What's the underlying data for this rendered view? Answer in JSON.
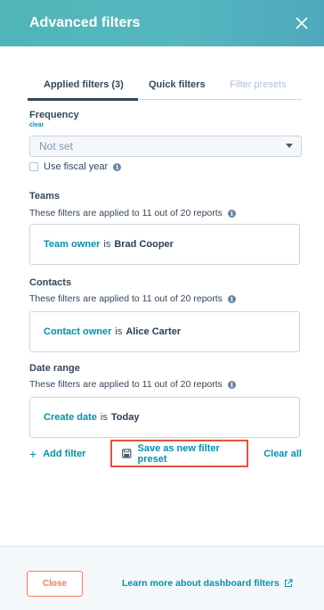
{
  "header": {
    "title": "Advanced filters",
    "close_icon": "close-icon"
  },
  "tabs": [
    {
      "label": "Applied filters (3)",
      "state": "active"
    },
    {
      "label": "Quick filters",
      "state": "inactive"
    },
    {
      "label": "Filter presets",
      "state": "disabled"
    }
  ],
  "frequency": {
    "label": "Frequency",
    "clear_label": "clear",
    "select_value": "Not set",
    "fiscal_year_label": "Use fiscal year",
    "fiscal_year_checked": false,
    "info_icon": "info-icon"
  },
  "groups": [
    {
      "label": "Teams",
      "description": "These filters are applied to 11 out of 20 reports",
      "filter": {
        "property": "Team owner",
        "operator": "is",
        "value": "Brad Cooper"
      }
    },
    {
      "label": "Contacts",
      "description": "These filters are applied to 11 out of 20 reports",
      "filter": {
        "property": "Contact owner",
        "operator": "is",
        "value": "Alice Carter"
      }
    },
    {
      "label": "Date range",
      "description": "These filters are applied to 11 out of 20 reports",
      "filter": {
        "property": "Create date",
        "operator": "is",
        "value": "Today"
      }
    }
  ],
  "actions": {
    "add_filter_label": "Add filter",
    "save_preset_label": "Save as new filter preset",
    "clear_all_label": "Clear all"
  },
  "footer": {
    "close_label": "Close",
    "learn_more_label": "Learn more about dashboard filters",
    "external_link_icon": "external-link-icon"
  },
  "colors": {
    "header_gradient_start": "#4fb5b8",
    "header_gradient_end": "#4ea8bc",
    "link": "#0091ae",
    "highlight_border": "#e5533d",
    "close_button": "#ff7a59"
  }
}
